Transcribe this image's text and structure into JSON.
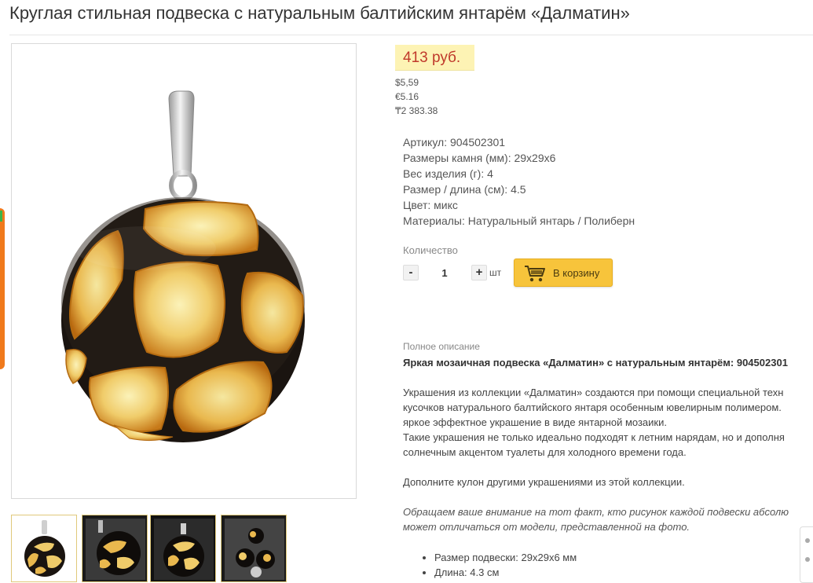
{
  "product": {
    "title": "Круглая стильная подвеска с натуральным балтийским янтарём «Далматин»"
  },
  "price": {
    "main": "413 руб.",
    "usd": "$5,59",
    "eur": "€5.16",
    "kzt": "₸2 383.38"
  },
  "specs": [
    {
      "label": "Артикул:",
      "value": "904502301"
    },
    {
      "label": "Размеры камня (мм):",
      "value": "29x29x6"
    },
    {
      "label": "Вес изделия (г):",
      "value": "4"
    },
    {
      "label": "Размер / длина (см):",
      "value": "4.5"
    },
    {
      "label": "Цвет:",
      "value": "микс"
    },
    {
      "label": "Материалы:",
      "value": "Натуральный янтарь / Полиберн"
    }
  ],
  "quantity": {
    "label": "Количество",
    "minus": "-",
    "value": "1",
    "plus": "+",
    "unit": "шт"
  },
  "cart": {
    "label": "В корзину",
    "icon": "cart-icon"
  },
  "description": {
    "label": "Полное описание",
    "heading": "Яркая мозаичная подвеска «Далматин» с натуральным янтарём: 904502301",
    "paragraph1": [
      "Украшения из коллекции «Далматин» создаются при помощи специальной техн",
      "кусочков натурального балтийского янтаря особенным ювелирным полимером.",
      "яркое эффектное украшение в виде янтарной мозаики.",
      "Такие украшения не только идеально подходят к летним нарядам, но и дополня",
      "солнечным акцентом туалеты для холодного времени года."
    ],
    "paragraph2": "Дополните кулон другими украшениями из этой коллекции.",
    "note": [
      "Обращаем ваше внимание на тот факт, кто рисунок каждой подвески абсолю",
      "может отличаться от модели, представленной на фото."
    ],
    "bullets": [
      "Размер подвески: 29x29x6 мм",
      "Длина: 4.3 см"
    ]
  },
  "colors": {
    "price_bg": "#fdf3b4",
    "price_text": "#c0392b",
    "cart_button": "#f7c43b",
    "thumb_border": "#e0c97a",
    "amber": "#e8b04a",
    "resin": "#1a1410"
  }
}
